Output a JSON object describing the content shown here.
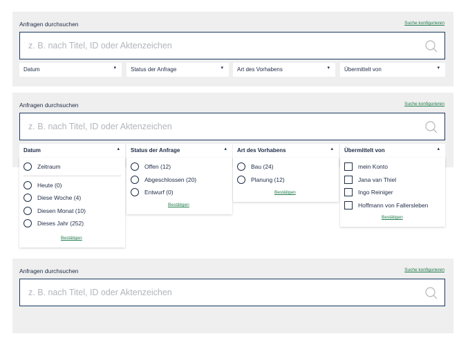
{
  "colors": {
    "navy": "#1d2b45",
    "border": "#17365f",
    "link_green": "#1f7a4a",
    "panel_bg": "#efefef",
    "placeholder": "#b2b5bb"
  },
  "panel1": {
    "title": "Anfragen durchsuchen",
    "configure": "Suche konfigurieren",
    "search_placeholder": "z. B. nach Titel, ID oder Aktenzeichen",
    "filters": [
      "Datum",
      "Status der Anfrage",
      "Art des Vorhabens",
      "Übermittelt von"
    ]
  },
  "panel2": {
    "title": "Anfragen durchsuchen",
    "configure": "Suche konfigurieren",
    "search_placeholder": "z. B. nach Titel, ID oder Aktenzeichen",
    "filters": [
      "Datum",
      "Status der Anfrage",
      "Art des Vorhabens",
      "Übermittelt von"
    ],
    "datum": {
      "options": [
        "Zeitraum",
        "Heute (0)",
        "Diese Woche (4)",
        "Diesen Monat (10)",
        "Dieses Jahr (252)"
      ],
      "confirm": "Bestätigen"
    },
    "status": {
      "options": [
        "Offen (12)",
        "Abgeschlossen (20)",
        "Entwurf (0)"
      ],
      "confirm": "Bestätigen"
    },
    "art": {
      "options": [
        "Bau (24)",
        "Planung (12)"
      ],
      "confirm": "Bestätigen"
    },
    "uebermittelt": {
      "options": [
        "mein Konto",
        "Jana van Thiel",
        "Ingo Reiniger",
        "Hoffmann von Fallersleben"
      ],
      "confirm": "Bestätigen"
    }
  },
  "panel3": {
    "title": "Anfragen durchsuchen",
    "configure": "Suche konfigurieren",
    "search_placeholder": "z. B. nach Titel, ID oder Aktenzeichen"
  },
  "icons": {
    "search": "search-icon",
    "caret_down": "caret-down-icon",
    "caret_up": "caret-up-icon",
    "radio": "radio-icon",
    "checkbox": "checkbox-icon"
  }
}
